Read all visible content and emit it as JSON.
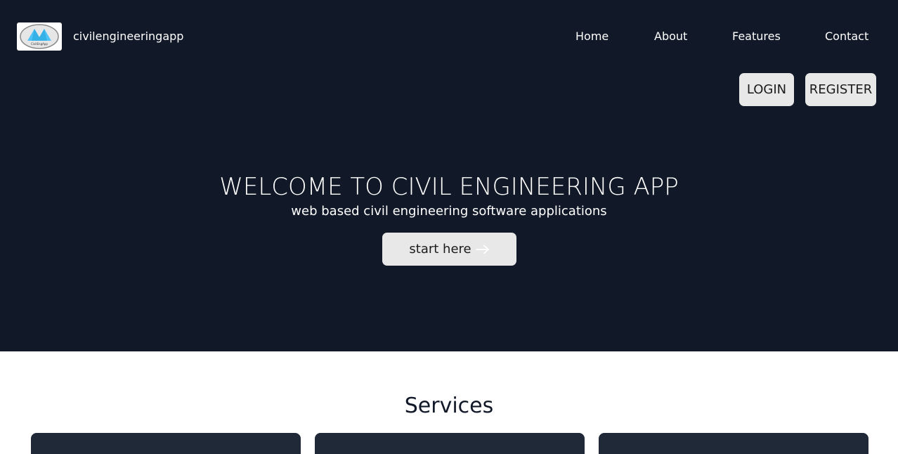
{
  "header": {
    "brand": "civilengineeringapp",
    "logo_text": "CivilEngApp",
    "nav": [
      {
        "label": "Home"
      },
      {
        "label": "About"
      },
      {
        "label": "Features"
      },
      {
        "label": "Contact"
      }
    ],
    "login_label": "LOGIN",
    "register_label": "REGISTER"
  },
  "hero": {
    "title": "WELCOME TO CIVIL ENGINEERING APP",
    "subtitle": "web based civil engineering software applications",
    "cta_label": "start here",
    "cta_icon": "arrow-right-icon"
  },
  "services": {
    "title": "Services",
    "cards": [
      {},
      {},
      {}
    ]
  },
  "colors": {
    "hero_bg": "#111827",
    "button_bg": "#e8e8e8",
    "card_bg": "#1f2937",
    "logo_accent": "#4fc3f7"
  }
}
